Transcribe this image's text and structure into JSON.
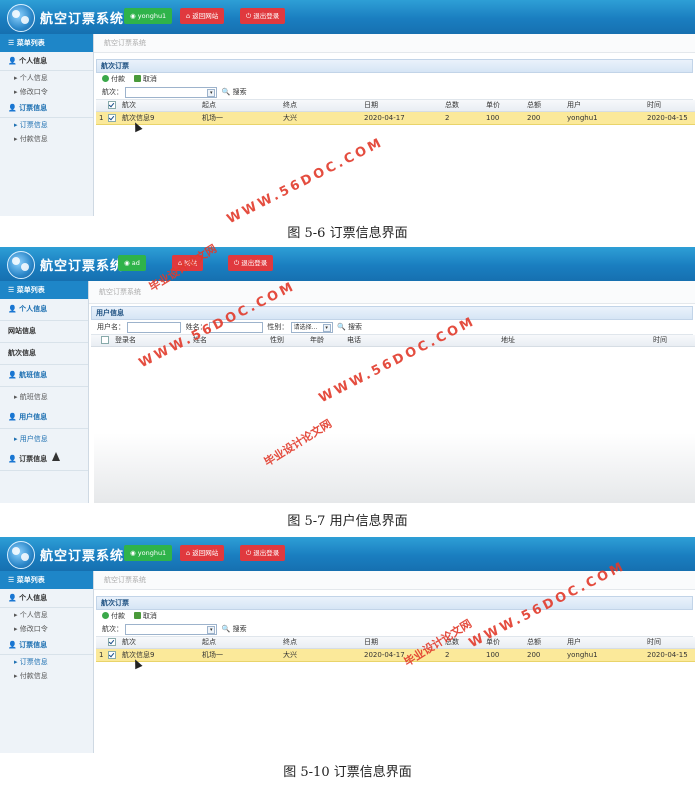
{
  "app": {
    "title": "航空订票系统",
    "user_button": "yonghu1",
    "home_button": "返回网站",
    "logout_button": "退出登录",
    "menu_header": "菜单列表",
    "breadcrumb": "航空订票系统"
  },
  "shot1": {
    "sidebar": {
      "group1": "个人信息",
      "item1": "个人信息",
      "item2": "修改口令",
      "group2": "订票信息",
      "item3": "订票信息",
      "item4": "付款信息"
    },
    "panel_title": "航次订票",
    "toolbar": {
      "pay": "付款",
      "cancel": "取消"
    },
    "filter": {
      "label": "航次：",
      "search": "搜索"
    },
    "columns": [
      "航次",
      "起点",
      "终点",
      "日期",
      "总数",
      "单价",
      "总额",
      "用户",
      "时间"
    ],
    "rows": [
      {
        "no": "1",
        "flight": "航次信息9",
        "from": "机场一",
        "to": "大兴",
        "date": "2020-04-17",
        "count": "2",
        "price": "100",
        "total": "200",
        "user": "yonghu1",
        "time": "2020-04-15"
      }
    ],
    "caption": "图 5-6 订票信息界面"
  },
  "shot2": {
    "sidebar": {
      "group1": "个人信息",
      "group2": "网站信息",
      "group3": "航次信息",
      "group4": "航班信息",
      "item1": "航班信息",
      "group5": "用户信息",
      "item2": "用户信息",
      "group6": "订票信息"
    },
    "user_button": "ad",
    "home_button": "网站",
    "breadcrumb": "航空订票系统",
    "panel_title": "用户信息",
    "filter": {
      "user_label": "用户名：",
      "name_label": "姓名：",
      "gender_label": "性别：",
      "gender_select": "请选择...",
      "search": "搜索"
    },
    "columns": [
      "登录名",
      "姓名",
      "性别",
      "年龄",
      "电话",
      "地址",
      "时间"
    ],
    "caption": "图 5-7 用户信息界面"
  },
  "shot3": {
    "caption": "图 5-10 订票信息界面"
  },
  "watermarks": {
    "site": "WWW.56DOC.COM",
    "name": "毕业设计论文网"
  },
  "colors": {
    "header_blue": "#1a7ec0",
    "green": "#2fb34a",
    "red": "#e0393e",
    "highlight_row": "#fbe99a",
    "watermark": "#e23a2b"
  }
}
